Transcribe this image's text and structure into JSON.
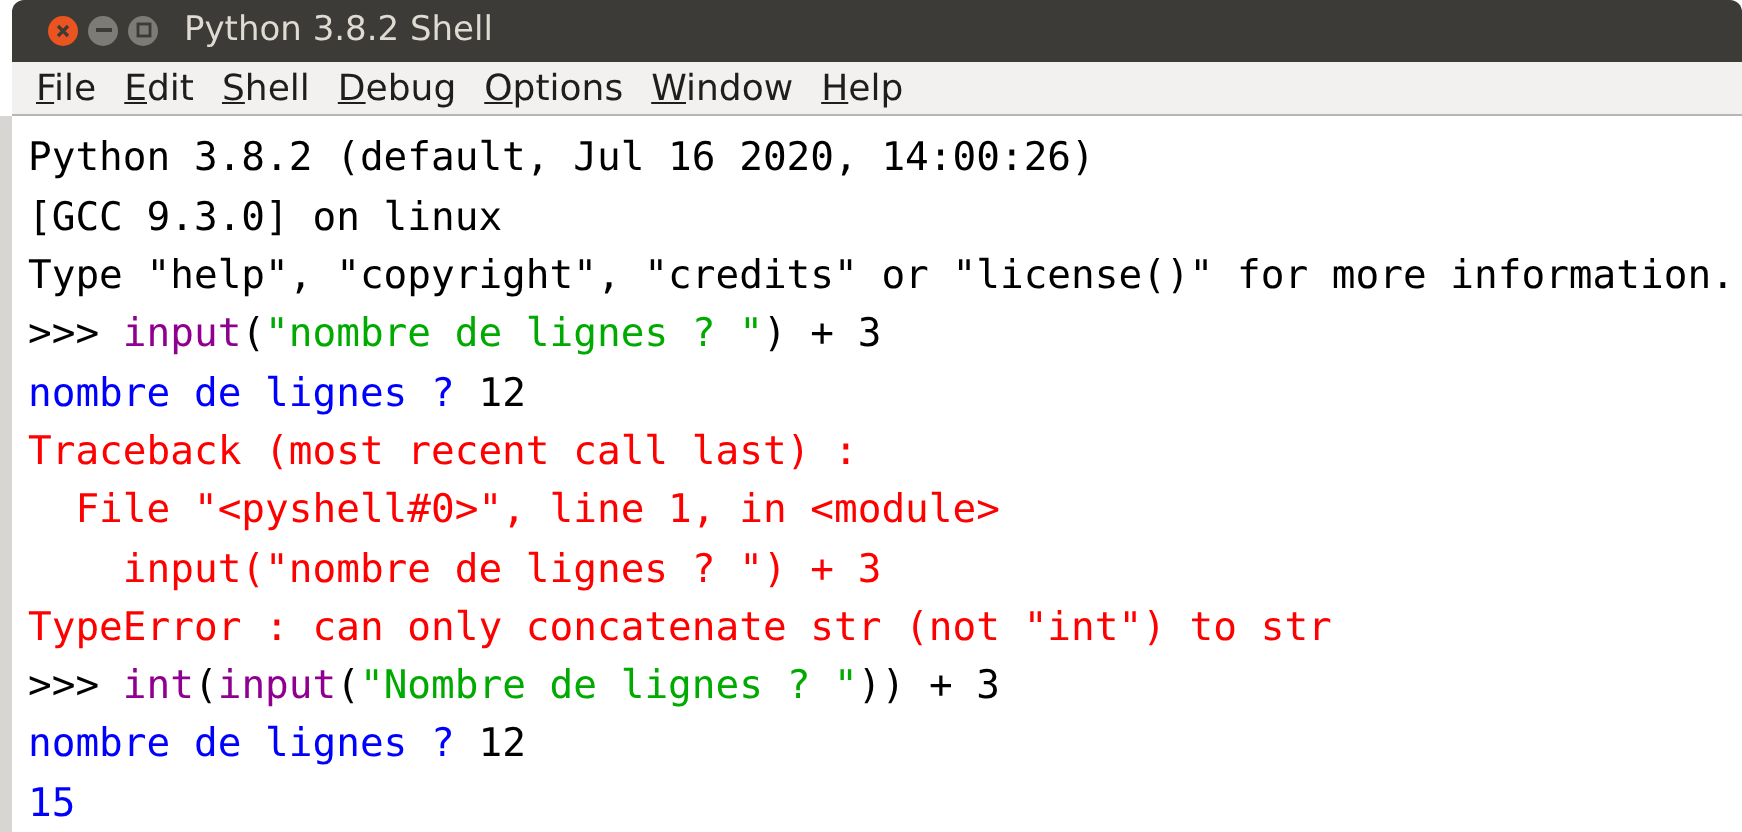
{
  "window": {
    "title": "Python 3.8.2 Shell"
  },
  "menu": [
    "File",
    "Edit",
    "Shell",
    "Debug",
    "Options",
    "Window",
    "Help"
  ],
  "lines": [
    [
      {
        "kind": "plain",
        "text": "Python 3.8.2 (default, Jul 16 2020, 14:00:26)"
      }
    ],
    [
      {
        "kind": "plain",
        "text": "[GCC 9.3.0] on linux"
      }
    ],
    [
      {
        "kind": "plain",
        "text": "Type \"help\", \"copyright\", \"credits\" or \"license()\" for more information."
      }
    ],
    [
      {
        "kind": "plain",
        "text": ">>> "
      },
      {
        "kind": "builtin",
        "text": "input"
      },
      {
        "kind": "plain",
        "text": "("
      },
      {
        "kind": "string",
        "text": "\"nombre de lignes ? \""
      },
      {
        "kind": "plain",
        "text": ") + 3"
      }
    ],
    [
      {
        "kind": "stdout",
        "text": "nombre de lignes ?"
      },
      {
        "kind": "plain",
        "text": " 12"
      }
    ],
    [
      {
        "kind": "error",
        "text": "Traceback (most recent call last) :"
      }
    ],
    [
      {
        "kind": "error",
        "text": "  File \"<pyshell#0>\", line 1, in <module>"
      }
    ],
    [
      {
        "kind": "error",
        "text": "    input(\"nombre de lignes ? \") + 3"
      }
    ],
    [
      {
        "kind": "error",
        "text": "TypeError : can only concatenate str (not \"int\") to str"
      }
    ],
    [
      {
        "kind": "plain",
        "text": ">>> "
      },
      {
        "kind": "builtin",
        "text": "int"
      },
      {
        "kind": "plain",
        "text": "("
      },
      {
        "kind": "builtin",
        "text": "input"
      },
      {
        "kind": "plain",
        "text": "("
      },
      {
        "kind": "string",
        "text": "\"Nombre de lignes ? \""
      },
      {
        "kind": "plain",
        "text": ")) + 3"
      }
    ],
    [
      {
        "kind": "stdout",
        "text": "nombre de lignes ?"
      },
      {
        "kind": "plain",
        "text": " 12"
      }
    ],
    [
      {
        "kind": "stdout",
        "text": "15"
      }
    ]
  ]
}
